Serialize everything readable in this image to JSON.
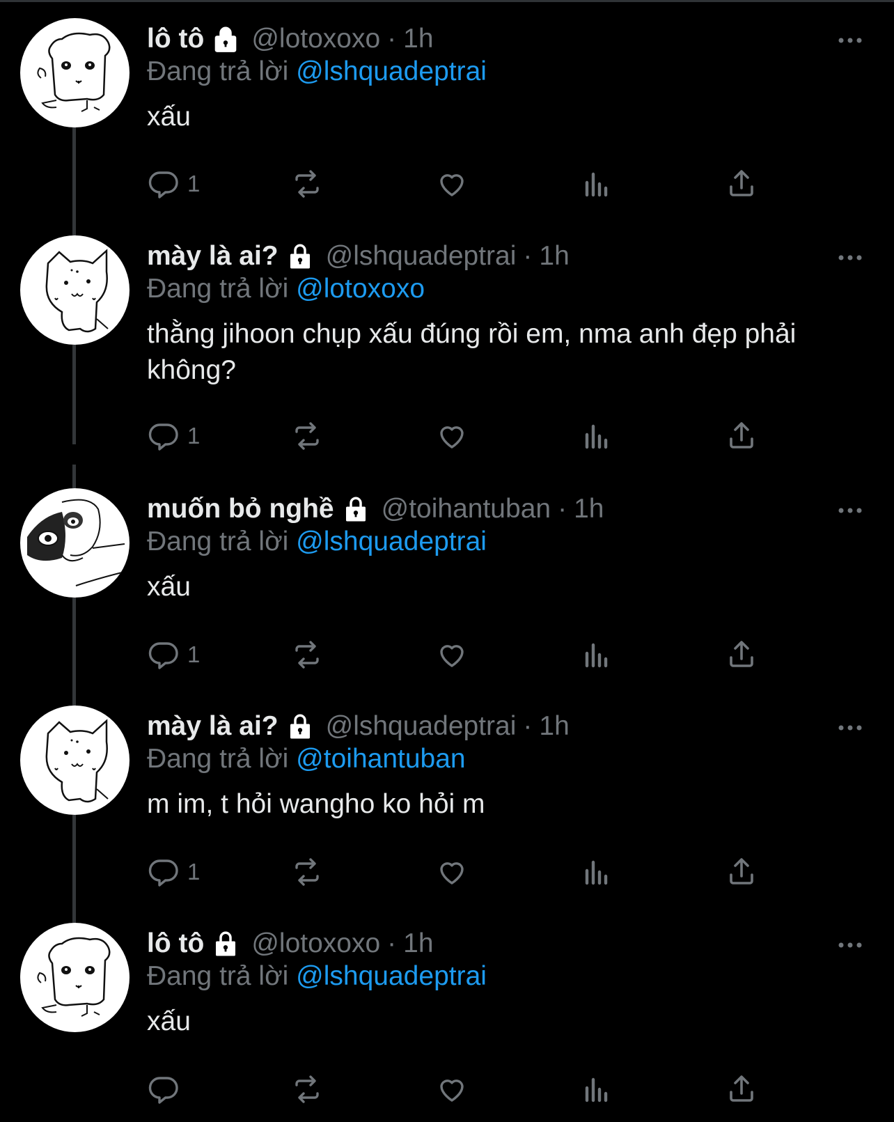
{
  "reply_prefix": "Đang trả lời",
  "colors": {
    "background": "#000000",
    "text": "#e7e9ea",
    "muted": "#71767b",
    "accent": "#1d9bf0"
  },
  "tweets": [
    {
      "name": "lô tô",
      "handle": "@lotoxoxo",
      "separator": "·",
      "time": "1h",
      "reply_to": "@lshquadeptrai",
      "text": "xấu",
      "reply_count": "1",
      "avatar": "dog-sketch"
    },
    {
      "name": "mày là ai?",
      "handle": "@lshquadeptrai",
      "separator": "·",
      "time": "1h",
      "reply_to": "@lotoxoxo",
      "text": "thằng jihoon chụp xấu đúng rồi em, nma anh đẹp phải không?",
      "reply_count": "1",
      "avatar": "cat-sketch"
    },
    {
      "name": "muốn bỏ nghề",
      "handle": "@toihantuban",
      "separator": "·",
      "time": "1h",
      "reply_to": "@lshquadeptrai",
      "text": "xấu",
      "reply_count": "1",
      "avatar": "face-sketch"
    },
    {
      "name": "mày là ai?",
      "handle": "@lshquadeptrai",
      "separator": "·",
      "time": "1h",
      "reply_to": "@toihantuban",
      "text": "m im, t hỏi wangho ko hỏi m",
      "reply_count": "1",
      "avatar": "cat-sketch"
    },
    {
      "name": "lô tô",
      "handle": "@lotoxoxo",
      "separator": "·",
      "time": "1h",
      "reply_to": "@lshquadeptrai",
      "text": "xấu",
      "reply_count": "",
      "avatar": "dog-sketch"
    }
  ]
}
